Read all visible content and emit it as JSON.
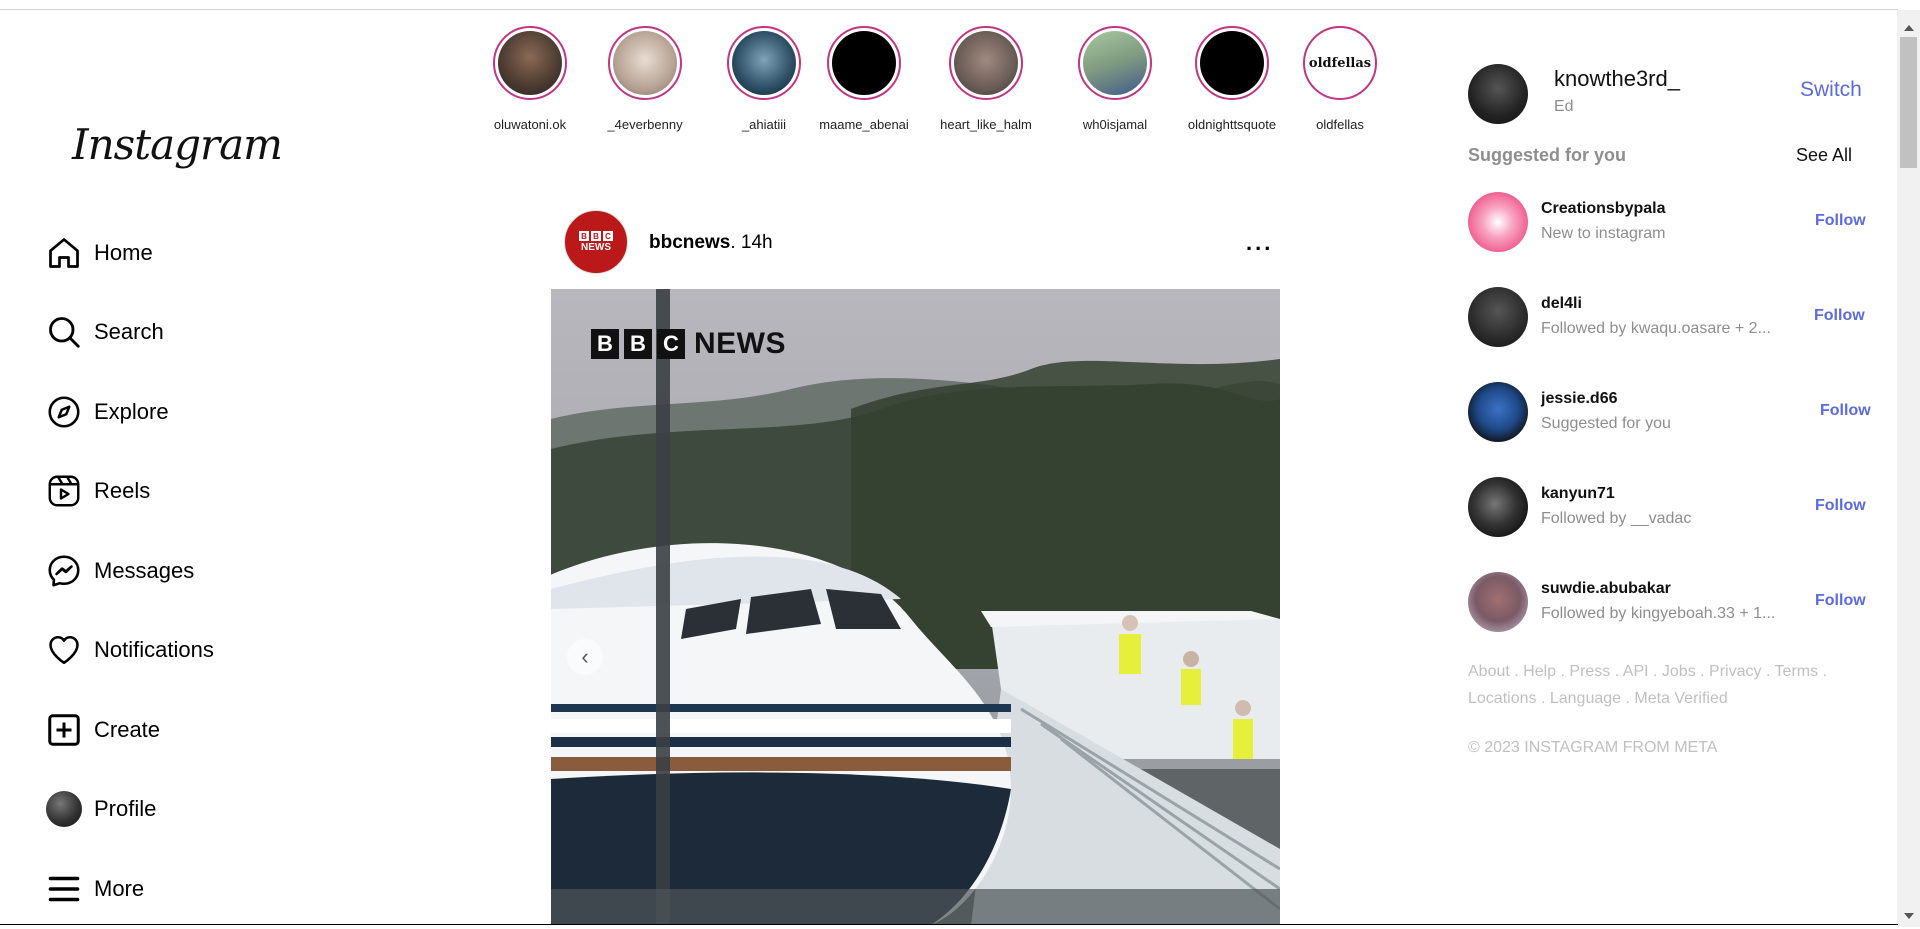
{
  "app": {
    "logo_text": "Instagram"
  },
  "sidebar": {
    "items": [
      {
        "label": "Home",
        "icon": "home-icon"
      },
      {
        "label": "Search",
        "icon": "search-icon"
      },
      {
        "label": "Explore",
        "icon": "compass-icon"
      },
      {
        "label": "Reels",
        "icon": "reels-icon"
      },
      {
        "label": "Messages",
        "icon": "messenger-icon"
      },
      {
        "label": "Notifications",
        "icon": "heart-icon"
      },
      {
        "label": "Create",
        "icon": "plus-square-icon"
      },
      {
        "label": "Profile",
        "icon": "avatar"
      },
      {
        "label": "More",
        "icon": "hamburger-icon"
      }
    ]
  },
  "stories": [
    {
      "username": "oluwatoni.ok",
      "color": "#5a4a40"
    },
    {
      "username": "_4everbenny",
      "color": "#c9b7a6"
    },
    {
      "username": "_ahiatiii",
      "color": "#2c4d63"
    },
    {
      "username": "maame_abenai",
      "color": "#000000"
    },
    {
      "username": "heart_like_halm",
      "color": "#6b5c56"
    },
    {
      "username": "wh0isjamal",
      "color": "#7f9a80"
    },
    {
      "username": "oldnighttsquote",
      "color": "#000000"
    },
    {
      "username": "oldfellas",
      "color": "#ffffff",
      "logo_text": "oldfellas"
    }
  ],
  "post": {
    "username": "bbcnews",
    "time_ago": "14h",
    "more_label": "...",
    "image_brand": {
      "letters": [
        "B",
        "B",
        "C"
      ],
      "word": "NEWS"
    }
  },
  "right": {
    "username": "knowthe3rd_",
    "name": "Ed",
    "switch_label": "Switch",
    "suggested_title": "Suggested for you",
    "see_all_label": "See All",
    "suggestions": [
      {
        "username": "Creationsbypala",
        "subtitle": "New to instagram",
        "follow_label": "Follow",
        "color": "#f06292"
      },
      {
        "username": "del4li",
        "subtitle": "Followed by kwaqu.oasare + 2...",
        "follow_label": "Follow",
        "color": "#2a2a2a"
      },
      {
        "username": "jessie.d66",
        "subtitle": "Suggested for you",
        "follow_label": "Follow",
        "color": "#1f4a8a"
      },
      {
        "username": "kanyun71",
        "subtitle": "Followed by __vadac",
        "follow_label": "Follow",
        "color": "#222222"
      },
      {
        "username": "suwdie.abubakar",
        "subtitle": "Followed by kingyeboah.33 + 1...",
        "follow_label": "Follow",
        "color": "#7a5a66"
      }
    ],
    "footer_links": [
      "About",
      "Help",
      "Press",
      "API",
      "Jobs",
      "Privacy",
      "Terms",
      "Locations",
      "Language",
      "Meta Verified"
    ],
    "copyright": "© 2023 INSTAGRAM FROM META"
  },
  "colors": {
    "accent": "#5b6ae0",
    "story_ring": "#c13584",
    "muted": "#8e8e8e",
    "bbc_red": "#bb1919"
  }
}
